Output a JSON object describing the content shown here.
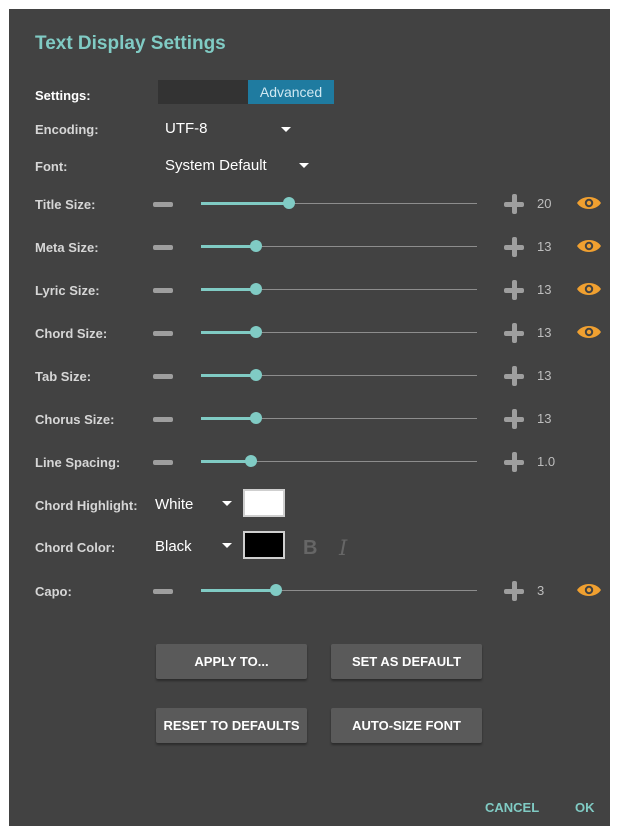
{
  "dialog": {
    "title": "Text Display Settings"
  },
  "settings": {
    "label": "Settings:",
    "mode_selected": "Advanced"
  },
  "encoding": {
    "label": "Encoding:",
    "value": "UTF-8"
  },
  "font": {
    "label": "Font:",
    "value": "System Default"
  },
  "sliders": [
    {
      "label": "Title Size:",
      "value": "20",
      "level": 0.32,
      "eye": true
    },
    {
      "label": "Meta Size:",
      "value": "13",
      "level": 0.2,
      "eye": true
    },
    {
      "label": "Lyric Size:",
      "value": "13",
      "level": 0.2,
      "eye": true
    },
    {
      "label": "Chord Size:",
      "value": "13",
      "level": 0.2,
      "eye": true
    },
    {
      "label": "Tab Size:",
      "value": "13",
      "level": 0.2,
      "eye": false
    },
    {
      "label": "Chorus Size:",
      "value": "13",
      "level": 0.2,
      "eye": false
    },
    {
      "label": "Line Spacing:",
      "value": "1.0",
      "level": 0.18,
      "eye": false
    }
  ],
  "chord_highlight": {
    "label": "Chord Highlight:",
    "value": "White",
    "color": "#ffffff"
  },
  "chord_color": {
    "label": "Chord Color:",
    "value": "Black",
    "color": "#000000"
  },
  "capo": {
    "label": "Capo:",
    "value": "3",
    "level": 0.27,
    "eye": true
  },
  "buttons": {
    "apply_to": "APPLY TO...",
    "set_as_default": "SET AS DEFAULT",
    "reset_to_defaults": "RESET TO DEFAULTS",
    "auto_size_font": "AUTO-SIZE FONT"
  },
  "footer": {
    "cancel": "CANCEL",
    "ok": "OK"
  },
  "colors": {
    "accent": "#80cbc4",
    "eye": "#f0a030",
    "segment_active": "#1f7ba0",
    "background": "#424242"
  }
}
